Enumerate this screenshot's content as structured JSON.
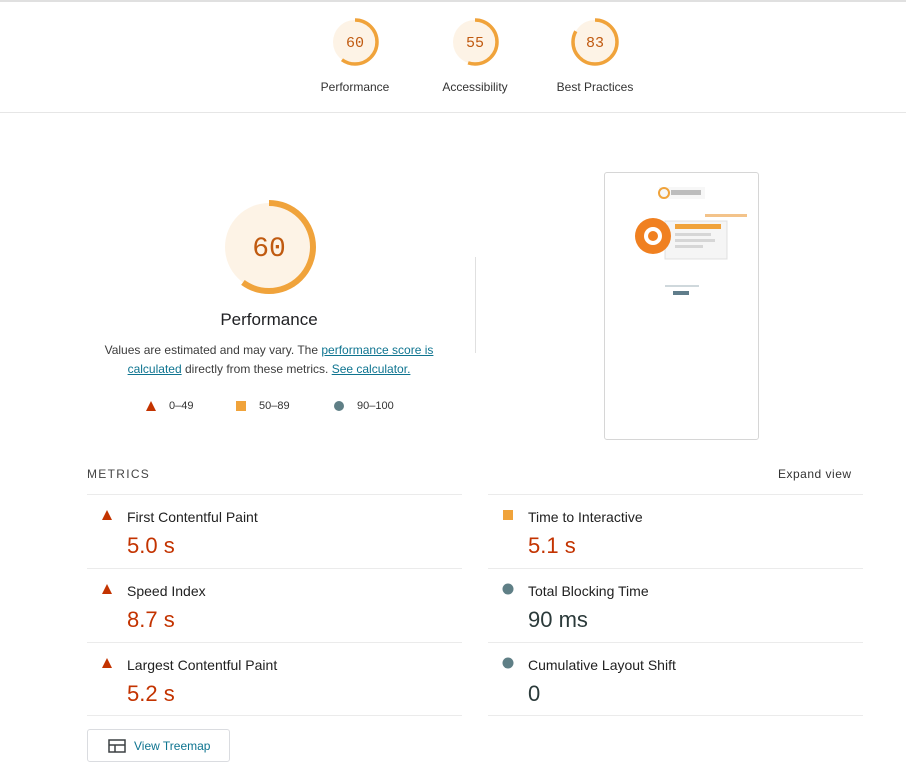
{
  "header_gauges": [
    {
      "score": "60",
      "label": "Performance",
      "fraction": 0.6
    },
    {
      "score": "55",
      "label": "Accessibility",
      "fraction": 0.55
    },
    {
      "score": "83",
      "label": "Best Practices",
      "fraction": 0.83
    }
  ],
  "performance": {
    "score": "60",
    "fraction": 0.6,
    "title": "Performance",
    "desc_prefix": "Values are estimated and may vary. The ",
    "link_score": "performance score is calculated",
    "desc_mid": " directly from these metrics. ",
    "link_calculator": "See calculator.",
    "legend": {
      "low": "0–49",
      "mid": "50–89",
      "high": "90–100"
    }
  },
  "metrics": {
    "header": "METRICS",
    "expand": "Expand view",
    "items": [
      {
        "name": "First Contentful Paint",
        "value": "5.0 s",
        "rating": "fail"
      },
      {
        "name": "Time to Interactive",
        "value": "5.1 s",
        "rating": "average"
      },
      {
        "name": "Speed Index",
        "value": "8.7 s",
        "rating": "fail"
      },
      {
        "name": "Total Blocking Time",
        "value": "90 ms",
        "rating": "pass"
      },
      {
        "name": "Largest Contentful Paint",
        "value": "5.2 s",
        "rating": "fail"
      },
      {
        "name": "Cumulative Layout Shift",
        "value": "0",
        "rating": "pass"
      }
    ]
  },
  "treemap_button": "View Treemap",
  "colors": {
    "fail": "#c33300",
    "average": "#f0a33b",
    "pass": "#5f7f86",
    "gauge_bg": "#fdf3e6",
    "gauge_arc": "#f0a33b"
  }
}
